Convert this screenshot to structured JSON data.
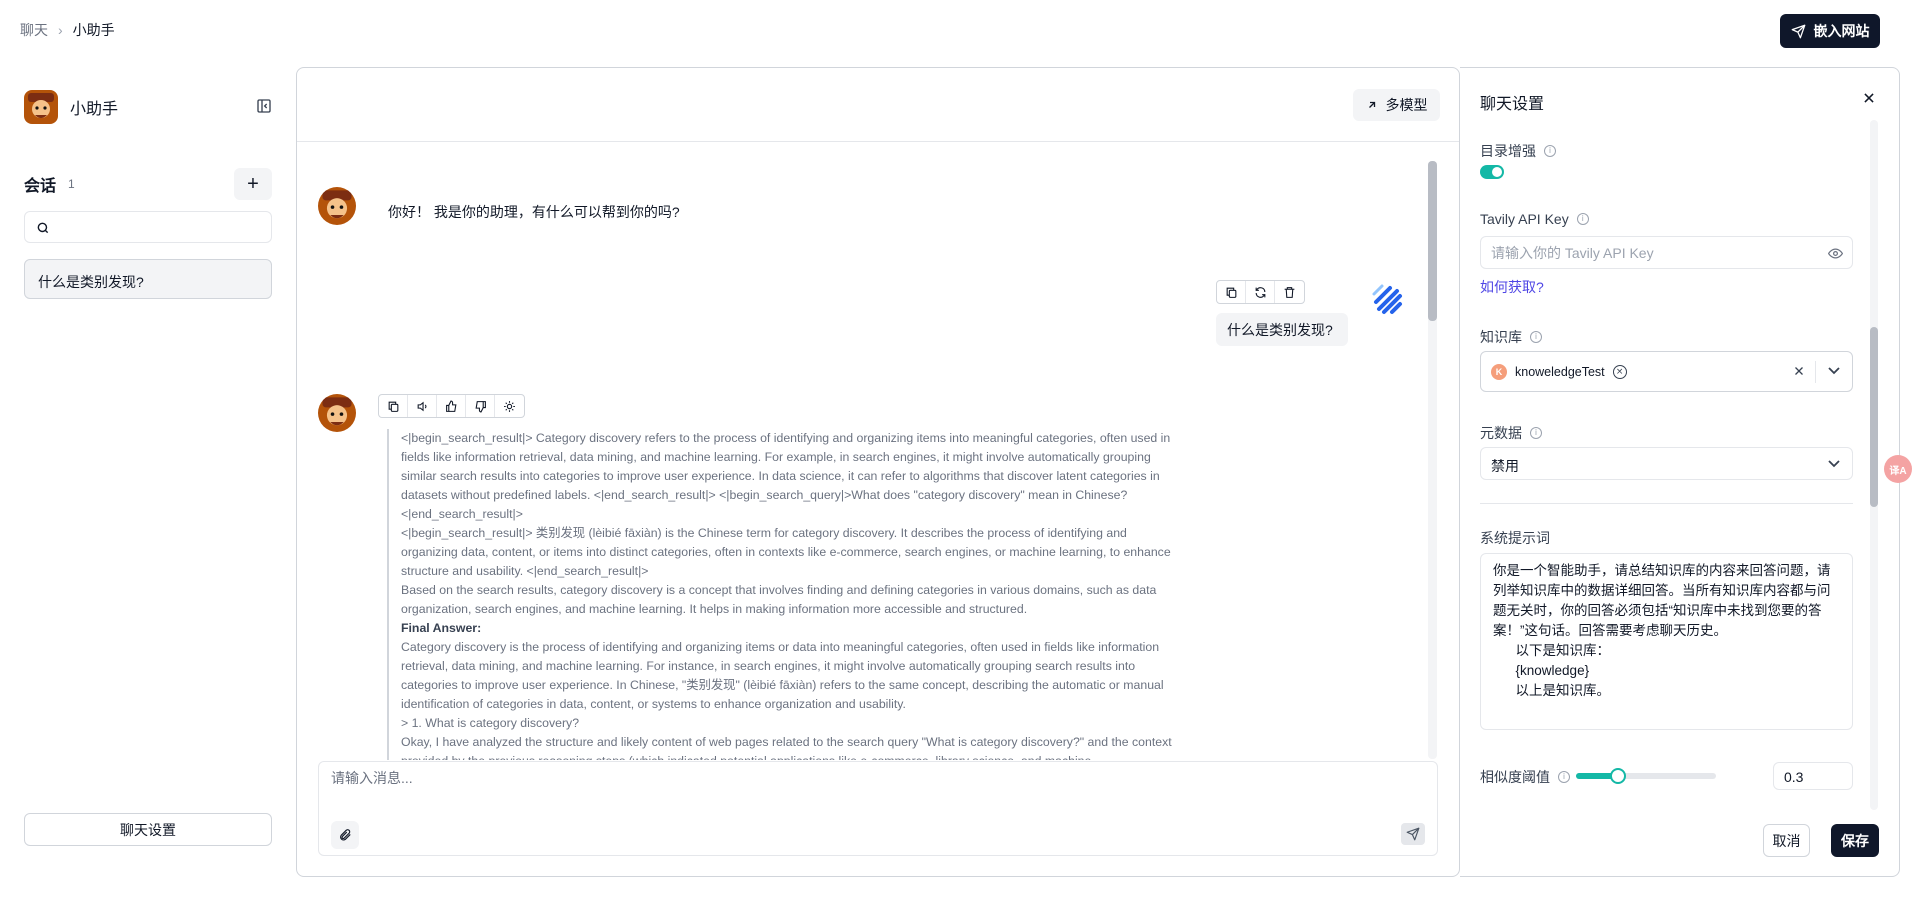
{
  "breadcrumb": {
    "parent": "聊天",
    "separator": "›",
    "current": "小助手"
  },
  "header": {
    "embed_button_label": "嵌入网站"
  },
  "sidebar": {
    "assistant_name": "小助手",
    "sessions_title": "会话",
    "sessions_count": "1",
    "add_label": "+",
    "search_placeholder": "",
    "sessions": [
      {
        "title": "什么是类别发现?"
      }
    ],
    "chat_settings_button": "聊天设置"
  },
  "chat": {
    "multi_model_button": "多模型",
    "greeting": "你好！ 我是你的助理，有什么可以帮到你的吗?",
    "user_message": "什么是类别发现?",
    "answer_lines": [
      "<|begin_search_result|> Category discovery refers to the process of identifying and organizing items into meaningful categories, often used in fields like information retrieval, data mining, and machine learning. For example, in search engines, it might involve automatically grouping similar search results into categories to improve user experience. In data science, it can refer to algorithms that discover latent categories in datasets without predefined labels. <|end_search_result|> <|begin_search_query|>What does \"category discovery\" mean in Chinese?<|end_search_result|>",
      "<|begin_search_result|> 类别发现 (lèibié fāxiàn) is the Chinese term for category discovery. It describes the process of identifying and organizing data, content, or items into distinct categories, often in contexts like e-commerce, search engines, or machine learning, to enhance structure and usability. <|end_search_result|>",
      "Based on the search results, category discovery is a concept that involves finding and defining categories in various domains, such as data organization, search engines, and machine learning. It helps in making information more accessible and structured."
    ],
    "final_answer_label": "Final Answer:",
    "final_answer_lines": [
      "Category discovery is the process of identifying and organizing items or data into meaningful categories, often used in fields like information retrieval, data mining, and machine learning. For instance, in search engines, it might involve automatically grouping search results into categories to improve user experience. In Chinese, \"类别发现\" (lèibié fāxiàn) refers to the same concept, describing the automatic or manual identification of categories in data, content, or systems to enhance organization and usability.",
      "> 1. What is category discovery?",
      "Okay, I have analyzed the structure and likely content of web pages related to the search query \"What is category discovery?\" and the context provided by the previous reasoning steps (which indicated potential applications like e-commerce, library science, and machine"
    ],
    "input_placeholder": "请输入消息..."
  },
  "settings": {
    "title": "聊天设置",
    "toc_enhance_label": "目录增强",
    "toc_enhance_enabled": true,
    "tavily_label": "Tavily API Key",
    "tavily_placeholder": "请输入你的 Tavily API Key",
    "how_to_get_link": "如何获取?",
    "knowledge_label": "知识库",
    "knowledge_tags": [
      {
        "letter": "K",
        "name": "knoweledgeTest"
      }
    ],
    "metadata_label": "元数据",
    "metadata_value": "禁用",
    "system_prompt_label": "系统提示词",
    "system_prompt_value": "你是一个智能助手，请总结知识库的内容来回答问题，请列举知识库中的数据详细回答。当所有知识库内容都与问题无关时，你的回答必须包括“知识库中未找到您要的答案！”这句话。回答需要考虑聊天历史。\n      以下是知识库：\n      {knowledge}\n      以上是知识库。",
    "similarity_label": "相似度阈值",
    "similarity_value": "0.3",
    "similarity_fraction": 0.3,
    "cancel_button": "取消",
    "save_button": "保存"
  },
  "translate_widget_label": "译A",
  "colors": {
    "primary_dark": "#0f172a",
    "accent_teal": "#14b8a6",
    "link": "#4f46e5"
  }
}
